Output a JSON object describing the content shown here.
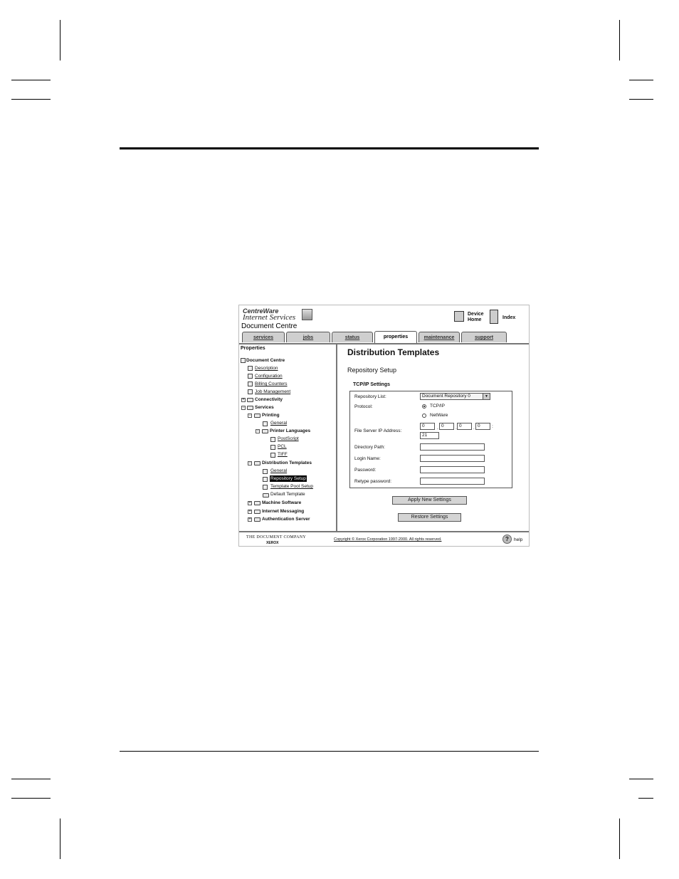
{
  "header": {
    "brand_line1": "CentreWare",
    "brand_line2": "Internet Services",
    "product": "Document Centre",
    "device_home_1": "Device",
    "device_home_2": "Home",
    "index": "Index"
  },
  "tabs": [
    {
      "label": "services"
    },
    {
      "label": "jobs"
    },
    {
      "label": "status"
    },
    {
      "label": "properties"
    },
    {
      "label": "maintenance"
    },
    {
      "label": "support"
    }
  ],
  "tree": {
    "title": "Properties",
    "items": [
      {
        "label": "Document Centre"
      },
      {
        "label": "Description"
      },
      {
        "label": "Configuration"
      },
      {
        "label": "Billing Counters"
      },
      {
        "label": "Job Management"
      },
      {
        "label": "Connectivity"
      },
      {
        "label": "Services"
      },
      {
        "label": "Printing"
      },
      {
        "label": "General"
      },
      {
        "label": "Printer Languages"
      },
      {
        "label": "PostScript"
      },
      {
        "label": "PCL"
      },
      {
        "label": "TIFF"
      },
      {
        "label": "Distribution Templates"
      },
      {
        "label": "General"
      },
      {
        "label": "Repository Setup"
      },
      {
        "label": "Template Pool Setup"
      },
      {
        "label": "Default Template"
      },
      {
        "label": "Machine Software"
      },
      {
        "label": "Internet Messaging"
      },
      {
        "label": "Authentication Server"
      }
    ]
  },
  "main": {
    "title": "Distribution Templates",
    "subtitle": "Repository Setup",
    "section": "TCP/IP Settings",
    "repository_label": "Repository List:",
    "repository_value": "Document Repository 0",
    "protocol_label": "Protocol:",
    "protocol_options": [
      "TCP/IP",
      "NetWare"
    ],
    "ip_label": "File Server IP Address:",
    "ip_octets": [
      "0",
      "0",
      "0",
      "0"
    ],
    "port": "21",
    "directory_label": "Directory Path:",
    "login_label": "Login Name:",
    "password_label": "Password:",
    "retype_label": "Retype password:",
    "apply_button": "Apply New Settings",
    "restore_button": "Restore Settings"
  },
  "footer": {
    "company": "THE DOCUMENT COMPANY",
    "brand": "XEROX",
    "copyright": "Copyright © Xerox Corporation 1997-2000. All rights reserved.",
    "help": "help"
  }
}
